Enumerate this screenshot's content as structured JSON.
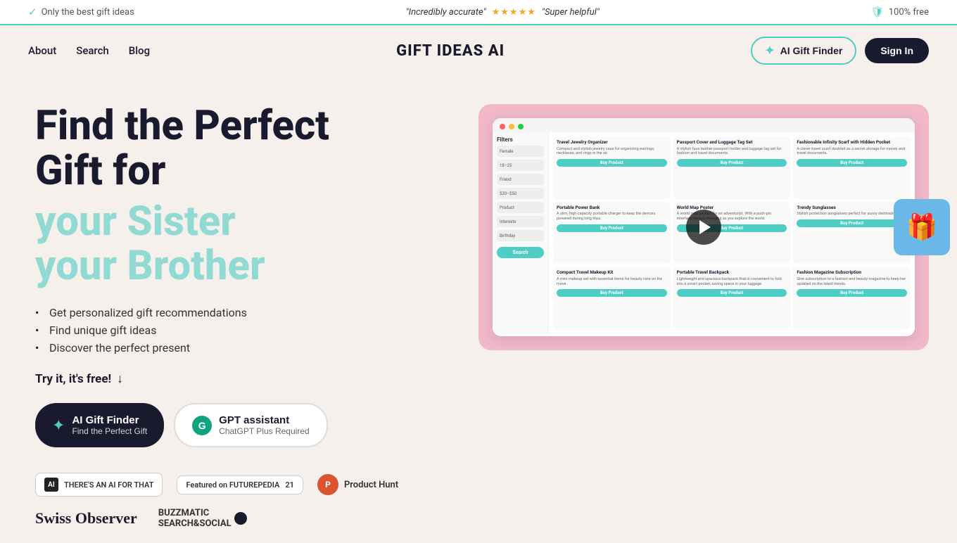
{
  "banner": {
    "left_text": "Only the best gift ideas",
    "quote1": "\"Incredibly accurate\"",
    "stars": "★★★★★",
    "quote2": "\"Super helpful\"",
    "right_text": "100% free"
  },
  "nav": {
    "about": "About",
    "search": "Search",
    "blog": "Blog",
    "brand": "GIFT IDEAS AI",
    "gift_finder_btn": "AI Gift Finder",
    "signin_btn": "Sign In"
  },
  "hero": {
    "title_line1": "Find the Perfect",
    "title_line2": "Gift for",
    "animated_line1": "your Sister",
    "animated_line2": "your Brother",
    "bullets": [
      "Get personalized gift recommendations",
      "Find unique gift ideas",
      "Discover the perfect present"
    ],
    "try_it": "Try it, it's free!",
    "cta1_title": "AI Gift Finder",
    "cta1_sub": "Find the Perfect Gift",
    "cta2_title": "GPT assistant",
    "cta2_sub": "ChatGPT Plus Required"
  },
  "badges": {
    "aiforthat": "THERE'S AN AI FOR THAT",
    "futurepedia": "Featured on FUTUREPEDIA",
    "futurepedia_count": "21",
    "producthunt": "Product Hunt"
  },
  "press": {
    "swiss_observer": "Swiss Observer",
    "buzzmatic": "BUZZMATIC SEARCH&SOCIAL"
  },
  "screenshot": {
    "filter_title": "Filters",
    "search_btn": "Search",
    "cards": [
      {
        "title": "Travel Jewelry Organizer",
        "desc": "Compact and stylish jewelry case for organizing earrings, necklaces, and rings in the air.",
        "btn": "Buy Product"
      },
      {
        "title": "Passport Cover and Luggage Tag Set",
        "desc": "A stylish faux leather passport holder and luggage tag set for fashion and travel documents.",
        "btn": "Buy Product"
      },
      {
        "title": "Fashionable Infinity Scarf with Hidden Pocket",
        "desc": "A clever travel scarf doubled as a secret storage for money and travel documents.",
        "btn": "Buy Product"
      },
      {
        "title": "Portable Power Bank",
        "desc": "A slim, high capacity portable charger to keep the devices powered during long trips.",
        "btn": "Buy Product"
      },
      {
        "title": "World Map Poster",
        "desc": "A world map perfect for an adventurist. With a push-pin interface always changing as you explore the world.",
        "btn": "Buy Product"
      },
      {
        "title": "Trendy Sunglasses",
        "desc": "Stylish protection sunglasses perfect for sunny destinations.",
        "btn": "Buy Product"
      },
      {
        "title": "Compact Travel Makeup Kit",
        "desc": "A mini makeup set with essential items for beauty care on the move.",
        "btn": "Buy Product"
      },
      {
        "title": "Portable Travel Backpack",
        "desc": "Lightweight and spacious backpack that is convenient to fold into a smart pocket, saving space in your luggage.",
        "btn": "Buy Product"
      },
      {
        "title": "Fashion Magazine Subscription",
        "desc": "Give subscription to a fashion and beauty magazine to keep her updated on the latest trends.",
        "btn": "Buy Product"
      }
    ]
  }
}
